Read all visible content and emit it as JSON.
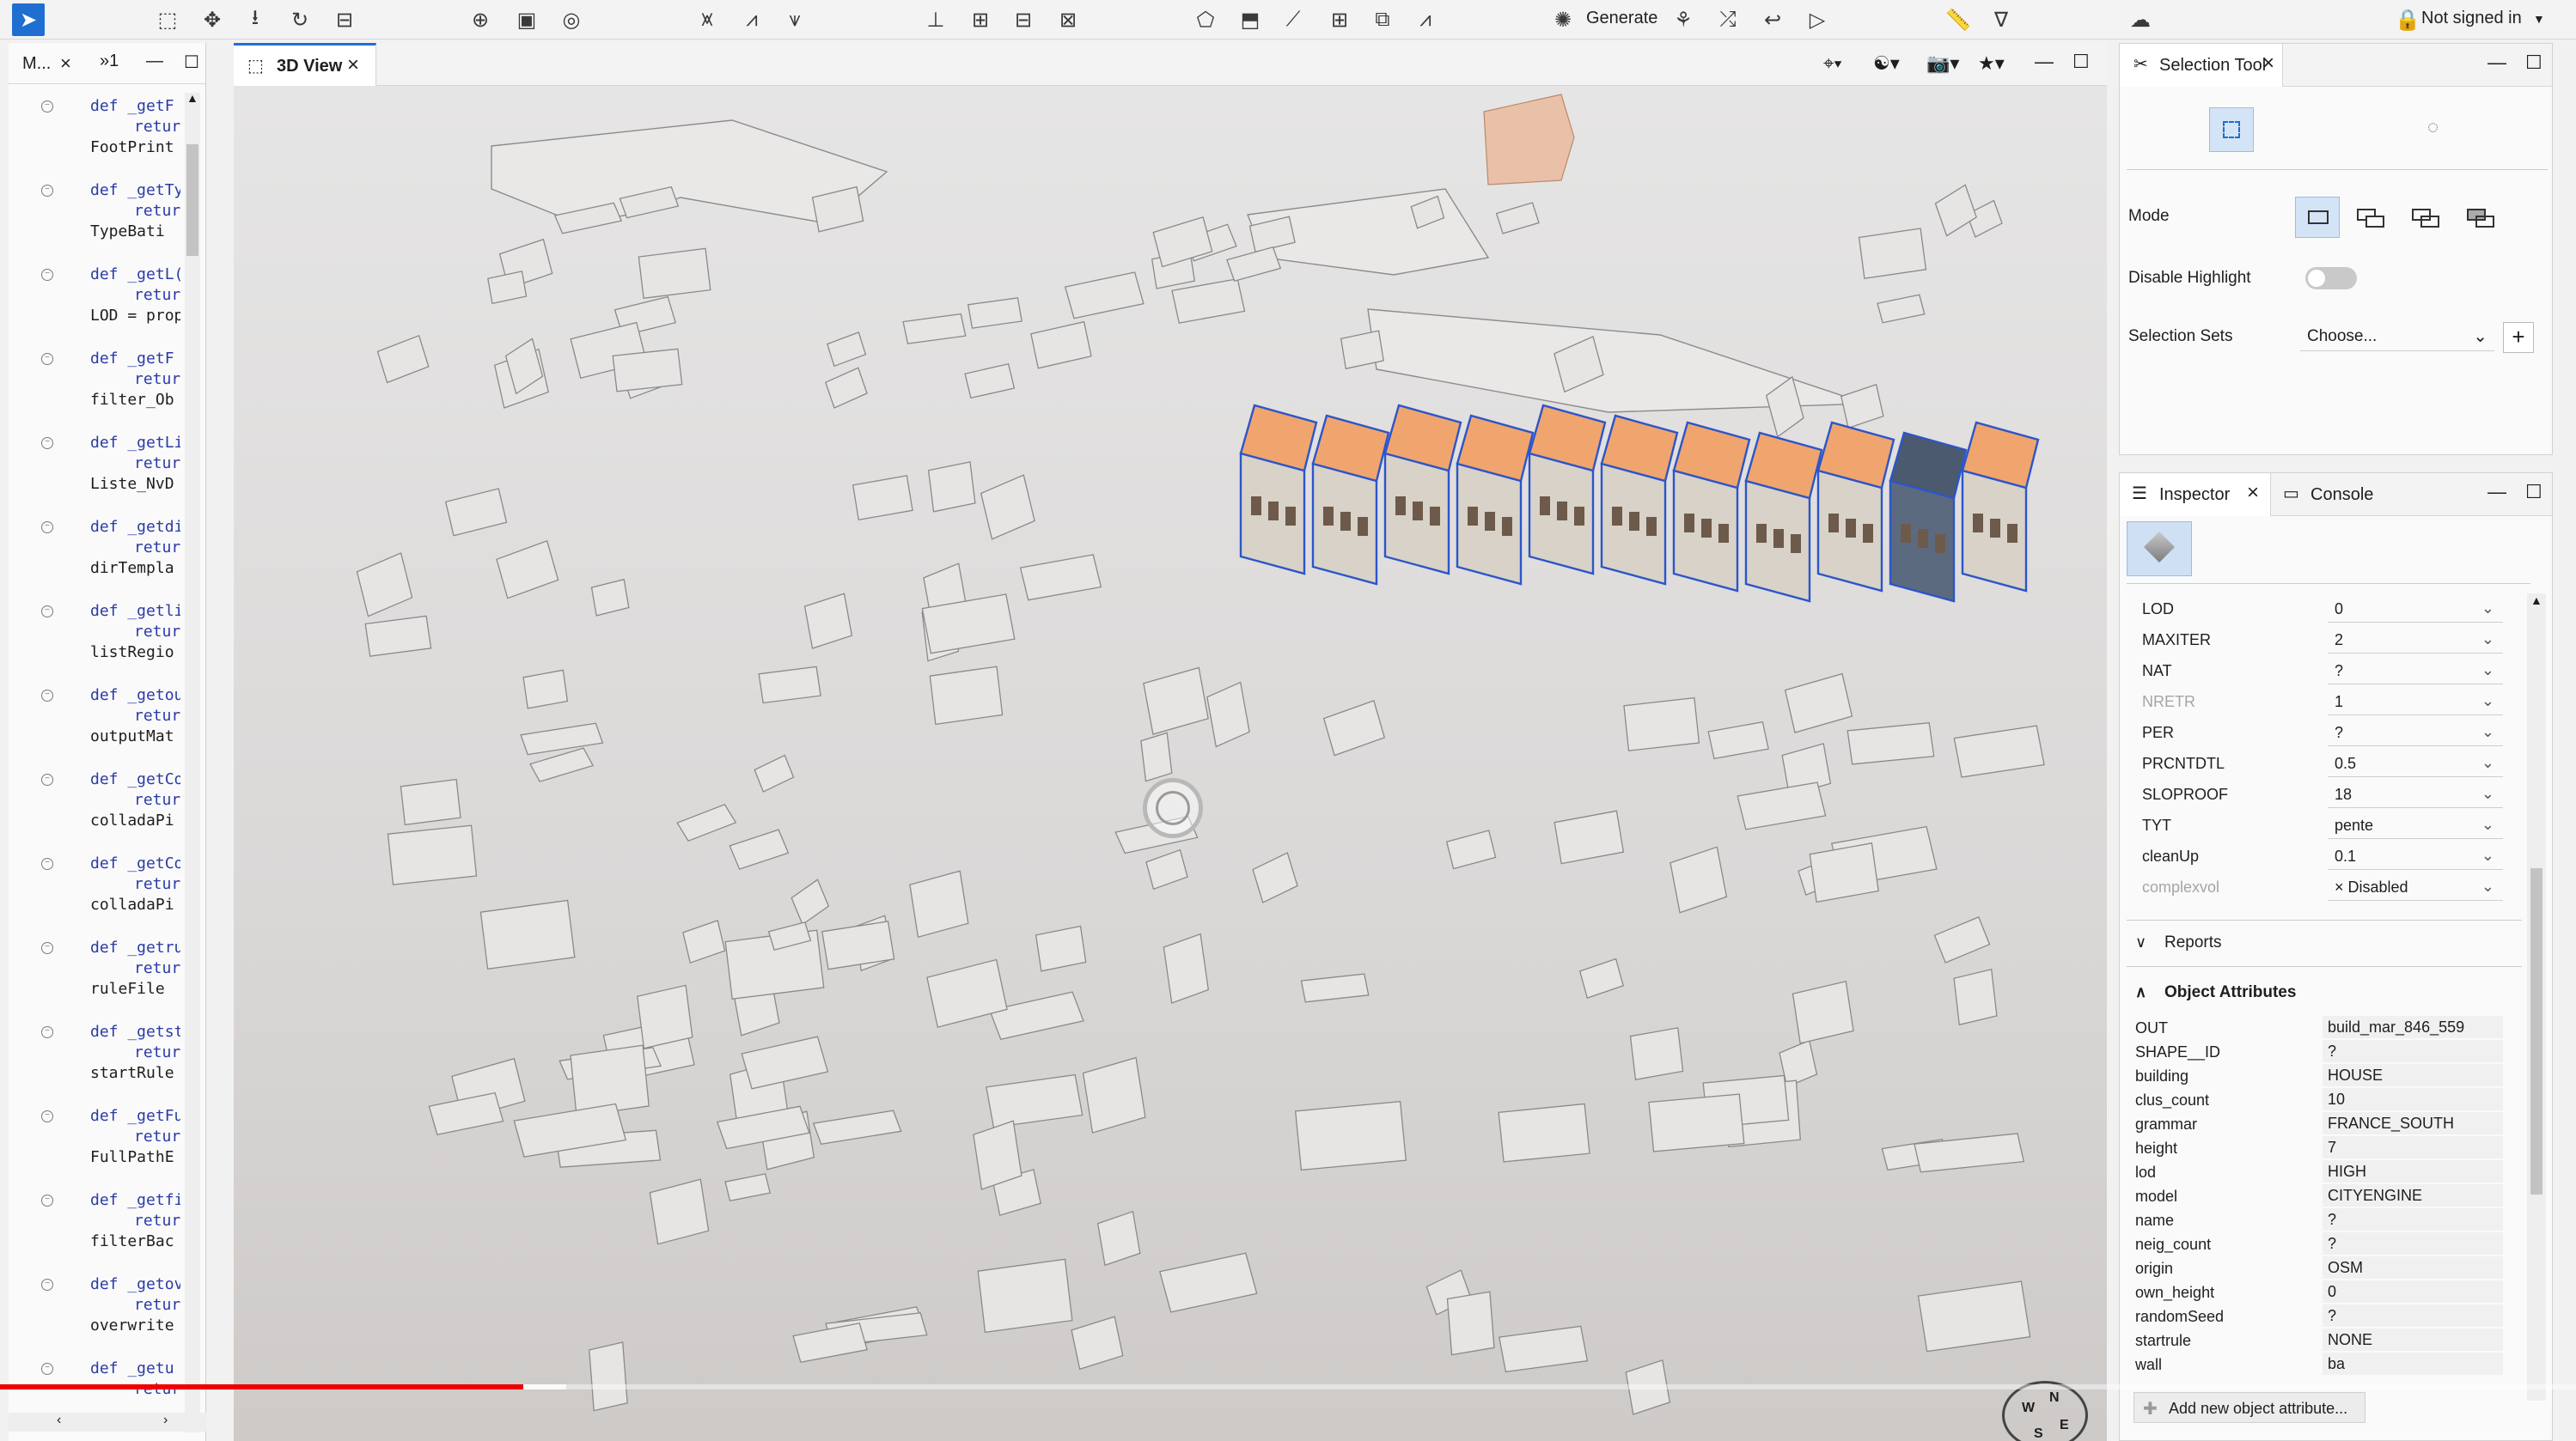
{
  "toolbar": {
    "generate_label": "Generate",
    "signed_in_label": "Not signed in"
  },
  "left_panel": {
    "tab_label": "M...",
    "tab2_label": "»1",
    "code_blocks": [
      {
        "def": "def _getF",
        "ret": "return",
        "val": "FootPrint"
      },
      {
        "def": "def _getTy",
        "ret": "return",
        "val": "TypeBati"
      },
      {
        "def": "def _getL(",
        "ret": "return",
        "val": "LOD = prop"
      },
      {
        "def": "def _getF",
        "ret": "return",
        "val": "filter_Ob"
      },
      {
        "def": "def _getLi",
        "ret": "return",
        "val": "Liste_NvD"
      },
      {
        "def": "def _getdi",
        "ret": "return",
        "val": "dirTempla"
      },
      {
        "def": "def _getli",
        "ret": "return",
        "val": "listRegio"
      },
      {
        "def": "def _getou",
        "ret": "return",
        "val": "outputMat"
      },
      {
        "def": "def _getCo",
        "ret": "return",
        "val": "colladaPi"
      },
      {
        "def": "def _getCo",
        "ret": "return",
        "val": "colladaPi"
      },
      {
        "def": "def _getru",
        "ret": "return",
        "val": "ruleFile"
      },
      {
        "def": "def _getst",
        "ret": "return",
        "val": "startRule"
      },
      {
        "def": "def _getFu",
        "ret": "return",
        "val": "FullPathE"
      },
      {
        "def": "def _getfi",
        "ret": "return",
        "val": "filterBac"
      },
      {
        "def": "def _getov",
        "ret": "return",
        "val": "overwrite"
      },
      {
        "def": "def _getu",
        "ret": "return",
        "val": ""
      }
    ]
  },
  "view3d": {
    "tab_label": "3D View"
  },
  "selection_tool": {
    "tab_label": "Selection Tool",
    "mode_label": "Mode",
    "disable_highlight_label": "Disable Highlight",
    "selection_sets_label": "Selection Sets",
    "selection_sets_value": "Choose..."
  },
  "inspector": {
    "tab_label": "Inspector",
    "console_label": "Console",
    "params": [
      {
        "name": "LOD",
        "value": "0",
        "disabled": false
      },
      {
        "name": "MAXITER",
        "value": "2",
        "disabled": false
      },
      {
        "name": "NAT",
        "value": "?",
        "disabled": false
      },
      {
        "name": "NRETR",
        "value": "1",
        "disabled": true
      },
      {
        "name": "PER",
        "value": "?",
        "disabled": false
      },
      {
        "name": "PRCNTDTL",
        "value": "0.5",
        "disabled": false
      },
      {
        "name": "SLOPROOF",
        "value": "18",
        "disabled": false
      },
      {
        "name": "TYT",
        "value": "pente",
        "disabled": false
      },
      {
        "name": "cleanUp",
        "value": "0.1",
        "disabled": false
      },
      {
        "name": "complexvol",
        "value": "× Disabled",
        "disabled": true
      }
    ],
    "reports_label": "Reports",
    "object_attributes_label": "Object Attributes",
    "attributes": [
      {
        "name": "OUT",
        "value": "build_mar_846_559"
      },
      {
        "name": "SHAPE__ID",
        "value": "?"
      },
      {
        "name": "building",
        "value": "HOUSE"
      },
      {
        "name": "clus_count",
        "value": "10"
      },
      {
        "name": "grammar",
        "value": "FRANCE_SOUTH"
      },
      {
        "name": "height",
        "value": "7"
      },
      {
        "name": "lod",
        "value": "HIGH"
      },
      {
        "name": "model",
        "value": "CITYENGINE"
      },
      {
        "name": "name",
        "value": "?"
      },
      {
        "name": "neig_count",
        "value": "?"
      },
      {
        "name": "origin",
        "value": "OSM"
      },
      {
        "name": "own_height",
        "value": "0"
      },
      {
        "name": "randomSeed",
        "value": "?"
      },
      {
        "name": "startrule",
        "value": "NONE"
      },
      {
        "name": "wall",
        "value": "ba"
      }
    ],
    "add_attribute_label": "Add new object attribute..."
  },
  "video": {
    "progress": 0.203
  },
  "colors": {
    "accent": "#1f6fd0",
    "progress": "#ee0000",
    "roof": "#f0a56e",
    "wall": "#d8d2c8"
  }
}
